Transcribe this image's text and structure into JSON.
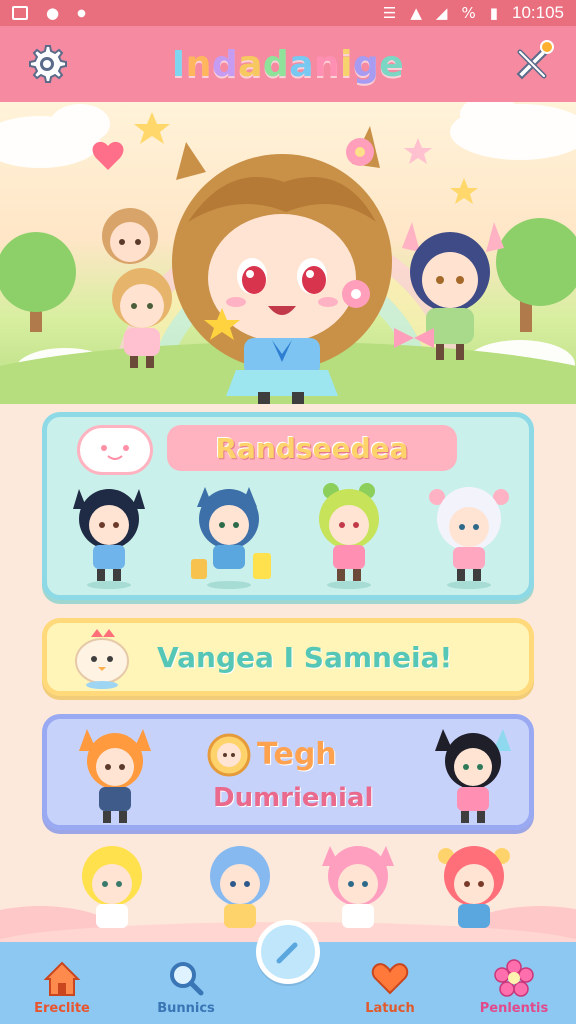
{
  "status_bar": {
    "time": "10:105"
  },
  "header": {
    "title": "Indadanige",
    "title_letter_colors": [
      "#7fd5f0",
      "#ffb65c",
      "#c59cf2",
      "#f7c85f",
      "#8fe29a",
      "#77c9f2",
      "#ff8fb3",
      "#f7d36e",
      "#a79cf2",
      "#7bd7c4"
    ],
    "settings_icon": "gear-icon",
    "notify_icon": "crossed-tools-icon"
  },
  "cards": {
    "teams": {
      "title": "Randseedea"
    },
    "versus": {
      "text": "Vangea I Samneia!"
    },
    "tech": {
      "title": "Tegh",
      "subtitle": "Dumrienial"
    }
  },
  "nav": {
    "items": [
      {
        "label": "Ereclite",
        "icon": "house-icon",
        "color": "#e8552f"
      },
      {
        "label": "Bunnics",
        "icon": "search-icon",
        "color": "#3a76b6"
      },
      {
        "label": "Latuch",
        "icon": "heart-icon",
        "color": "#e05a2e"
      },
      {
        "label": "Penlentis",
        "icon": "flower-icon",
        "color": "#e24a8c"
      }
    ],
    "center_icon": "pencil-icon"
  },
  "colors": {
    "header_bg": "#f58aa0",
    "status_bg": "#e96f7e",
    "nav_bg": "#8cc8f1",
    "teams_card": "#c9f0ea",
    "versus_card": "#fff5b8",
    "tech_card": "#c7d2fb"
  }
}
